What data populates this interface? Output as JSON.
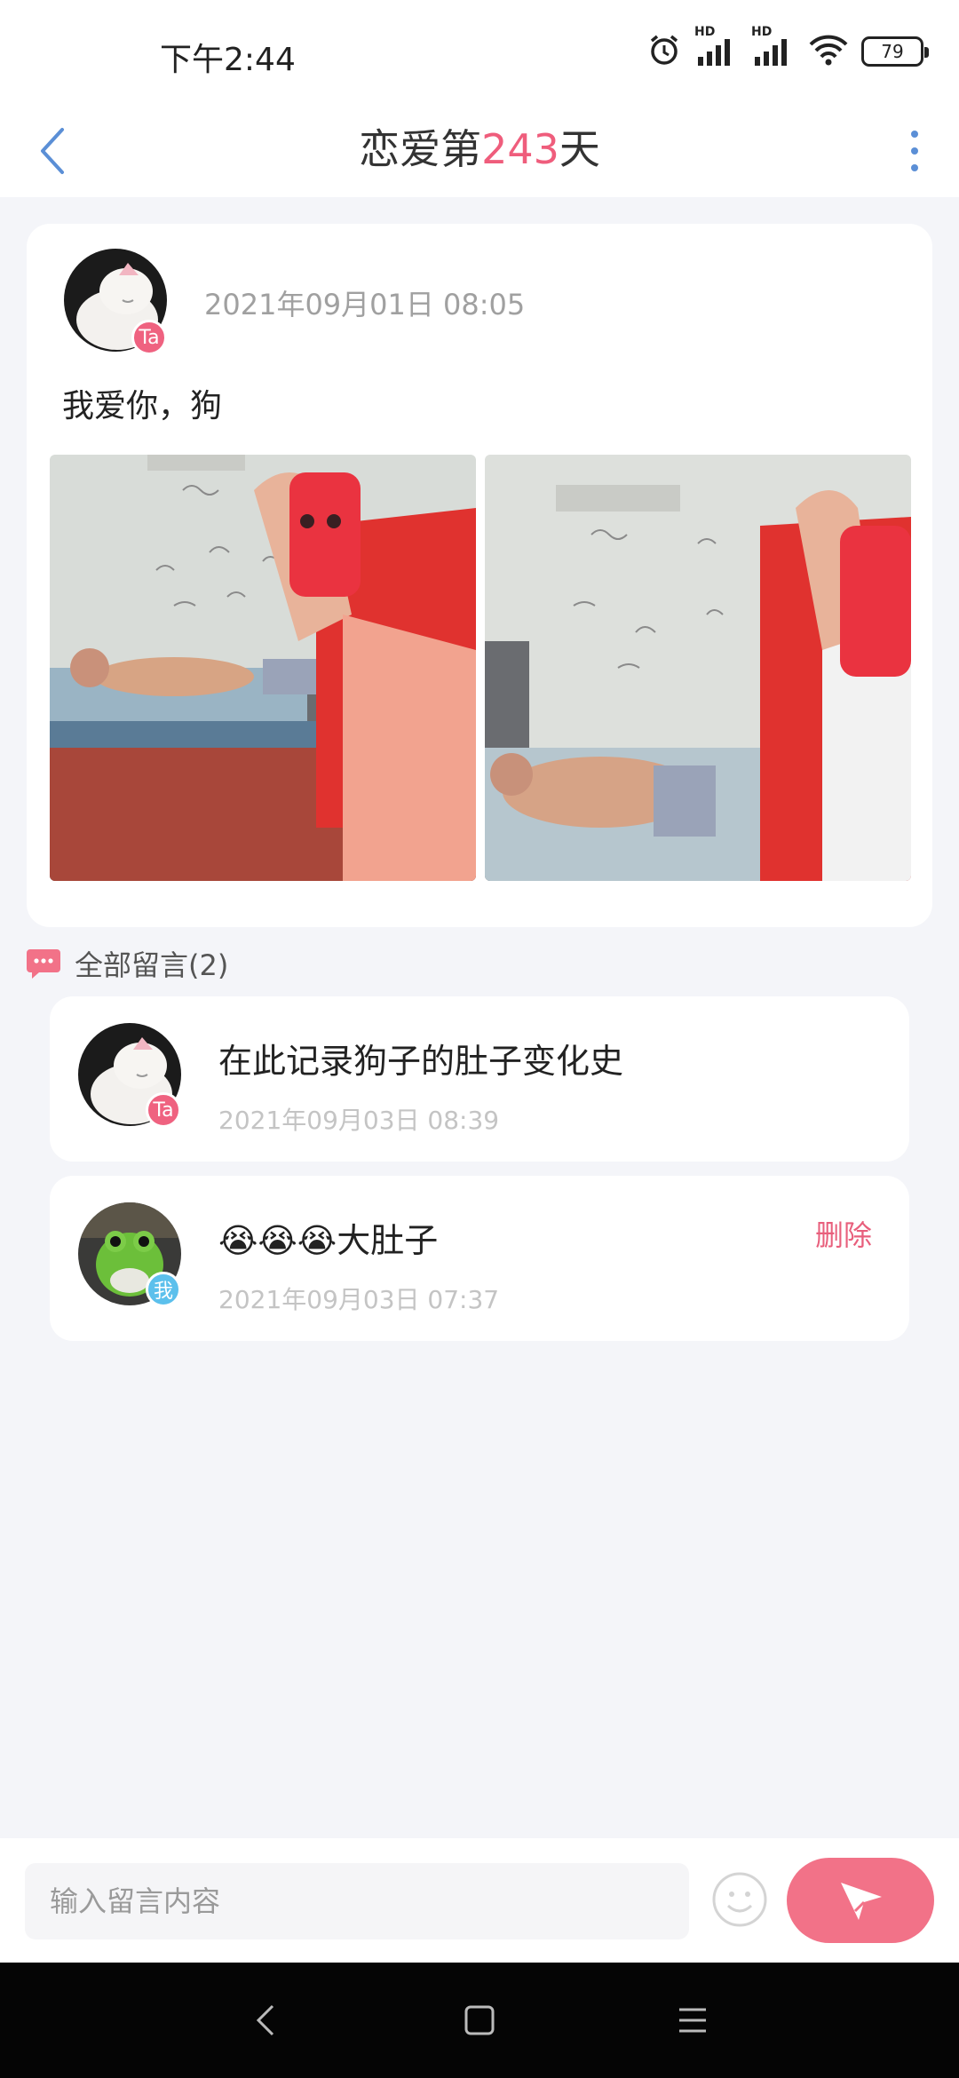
{
  "status_bar": {
    "time": "下午2:44",
    "battery": "79",
    "hd1": "HD",
    "hd2": "HD"
  },
  "header": {
    "title_prefix": "恋爱第",
    "day_count": "243",
    "title_suffix": "天"
  },
  "post": {
    "avatar_badge": "Ta",
    "date": "2021年09月01日 08:05",
    "text": "我爱你，狗"
  },
  "comments_section": {
    "title": "全部留言(2)"
  },
  "comments": [
    {
      "badge": "Ta",
      "text": "在此记录狗子的肚子变化史",
      "date": "2021年09月03日 08:39"
    },
    {
      "badge": "我",
      "text": "😭😭😭大肚子",
      "date": "2021年09月03日 07:37",
      "delete_label": "删除"
    }
  ],
  "input": {
    "placeholder": "输入留言内容"
  },
  "colors": {
    "accent": "#ef5d7c",
    "send": "#f27288",
    "badge_ta": "#ef6280",
    "badge_me": "#5cc0ec",
    "link_blue": "#5b8fd6"
  },
  "icons": [
    "back-arrow-icon",
    "more-vertical-icon",
    "alarm-icon",
    "signal-icon",
    "wifi-icon",
    "battery-icon",
    "comment-bubble-icon",
    "emoji-icon",
    "send-icon",
    "nav-back-icon",
    "nav-home-icon",
    "nav-menu-icon"
  ]
}
